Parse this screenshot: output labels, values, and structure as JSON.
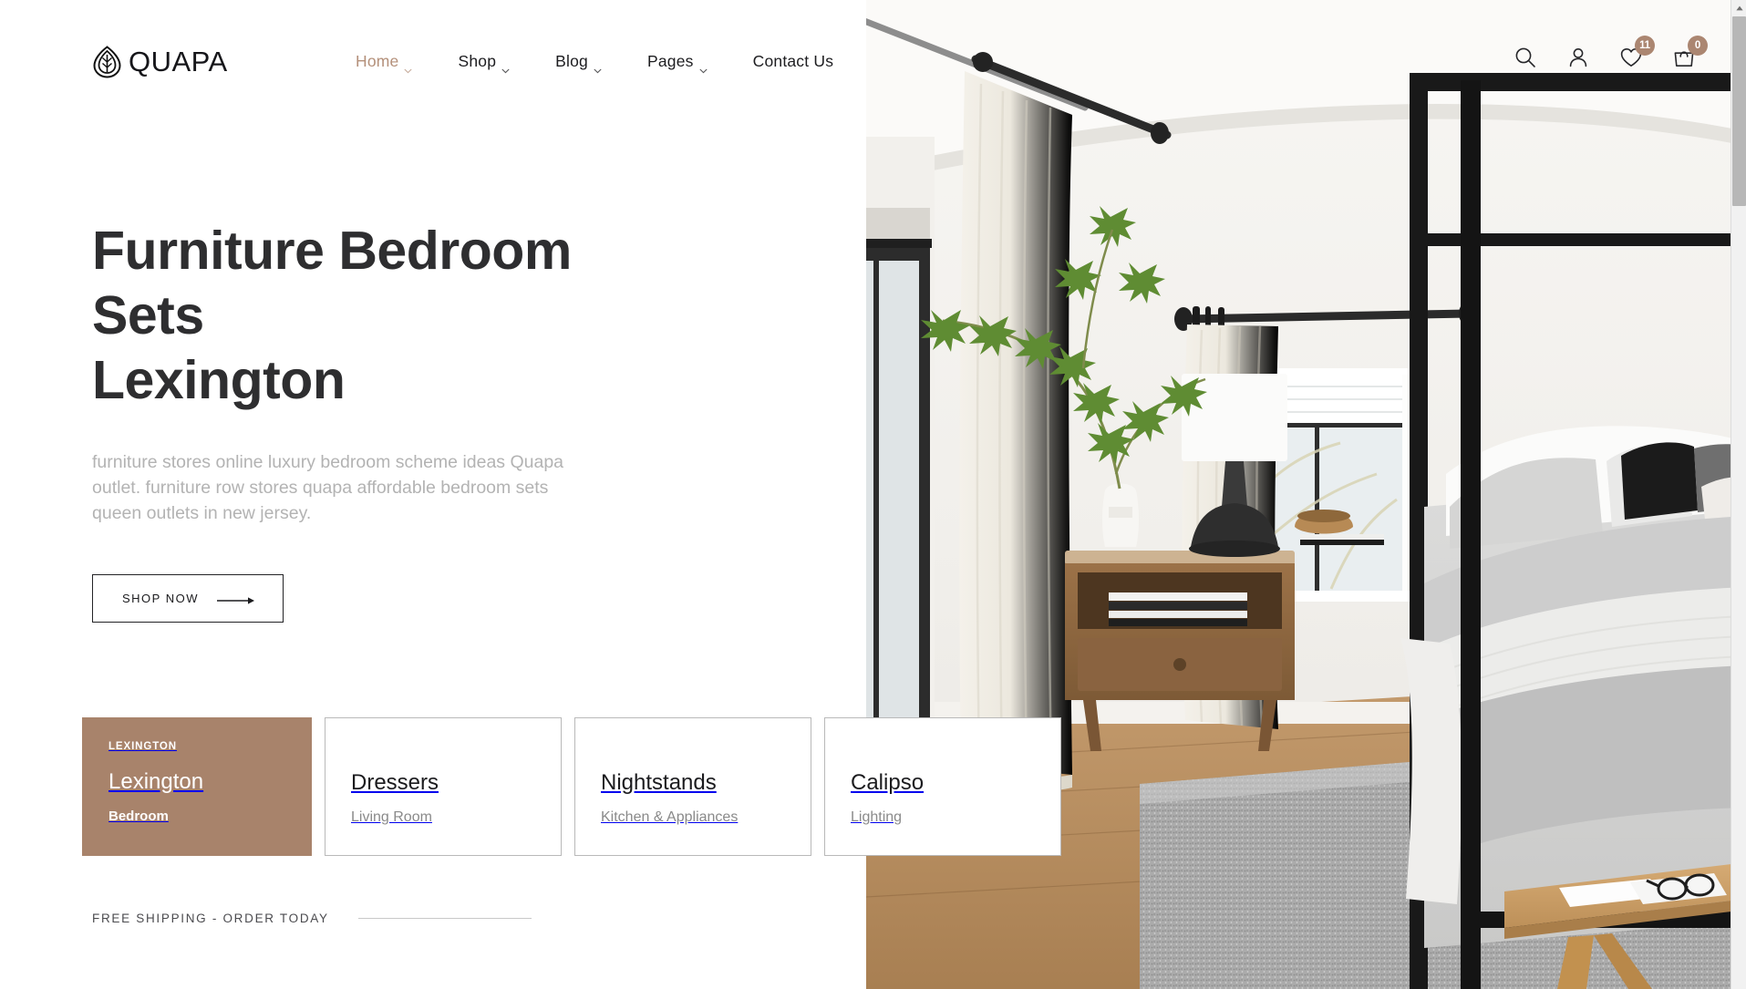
{
  "brand": {
    "name": "QUAPA",
    "logo_icon": "leaf-lotus-icon"
  },
  "nav": {
    "items": [
      {
        "label": "Home",
        "has_dropdown": true,
        "active": true
      },
      {
        "label": "Shop",
        "has_dropdown": true,
        "active": false
      },
      {
        "label": "Blog",
        "has_dropdown": true,
        "active": false
      },
      {
        "label": "Pages",
        "has_dropdown": true,
        "active": false
      },
      {
        "label": "Contact Us",
        "has_dropdown": false,
        "active": false
      }
    ]
  },
  "header_actions": {
    "search_icon": "search-icon",
    "account_icon": "user-icon",
    "wishlist_icon": "heart-icon",
    "wishlist_count": "11",
    "cart_icon": "shopping-bag-icon",
    "cart_count": "0"
  },
  "hero": {
    "title_line1": "Furniture Bedroom Sets",
    "title_line2": "Lexington",
    "paragraph": "furniture stores online luxury bedroom scheme ideas Quapa outlet. furniture row stores quapa affordable bedroom sets queen outlets in new jersey.",
    "cta_label": "SHOP NOW",
    "cta_icon": "arrow-right-icon",
    "image_alt": "bedroom-interior-photo"
  },
  "categories": [
    {
      "eyebrow": "LEXINGTON",
      "title": "Lexington",
      "subtitle": "Bedroom",
      "featured": true
    },
    {
      "eyebrow": "",
      "title": "Dressers",
      "subtitle": "Living Room",
      "featured": false
    },
    {
      "eyebrow": "",
      "title": "Nightstands",
      "subtitle": "Kitchen & Appliances",
      "featured": false
    },
    {
      "eyebrow": "",
      "title": "Calipso",
      "subtitle": "Lighting",
      "featured": false
    }
  ],
  "shipping_strip": {
    "label": "FREE SHIPPING - ORDER TODAY"
  },
  "colors": {
    "accent": "#b4907a",
    "featured_card_bg": "#a8836b",
    "badge_bg": "#ab8671",
    "heading": "#2e2e30",
    "muted_text": "#b3b3b3",
    "page_bg": "#ffffff"
  }
}
